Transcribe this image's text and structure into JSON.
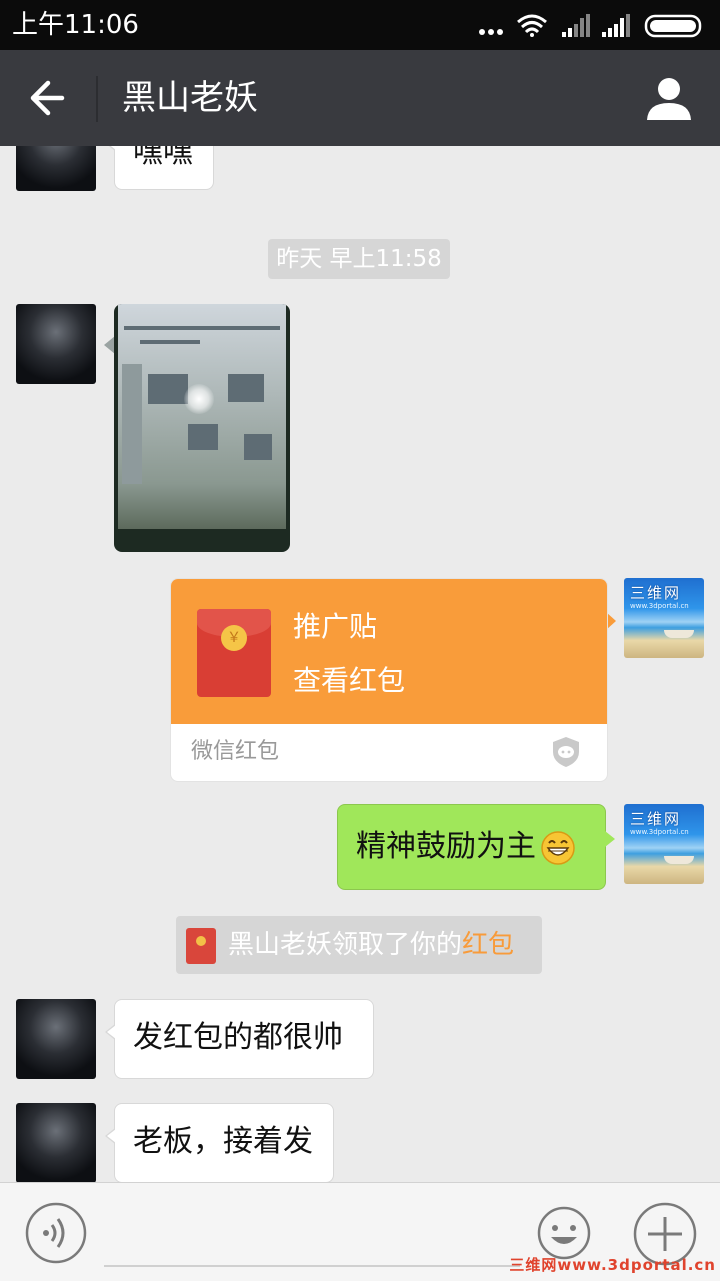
{
  "status_bar": {
    "time": "上午11:06",
    "icons": [
      "more-dots-icon",
      "wifi-icon",
      "signal-icon",
      "signal-icon",
      "battery-icon"
    ]
  },
  "header": {
    "title": "黑山老妖",
    "back_icon": "back-arrow-icon",
    "profile_icon": "person-icon"
  },
  "messages": {
    "m1": {
      "sender": "other",
      "text": "嘿嘿"
    },
    "timestamp": "昨天 早上11:58",
    "m2": {
      "sender": "other",
      "type": "image"
    },
    "m3": {
      "sender": "me",
      "type": "red_packet",
      "title": "推广贴",
      "subtitle": "查看红包",
      "footer": "微信红包",
      "coin_symbol": "￥"
    },
    "m4": {
      "sender": "me",
      "text": "精神鼓励为主"
    },
    "system_notice": {
      "prefix": "黑山老妖领取了你的",
      "link": "红包"
    },
    "m5": {
      "sender": "other",
      "text": "发红包的都很帅"
    },
    "m6": {
      "sender": "other",
      "text": "老板，接着发"
    }
  },
  "avatar_me": {
    "brand": "三维网",
    "url": "www.3dportal.cn"
  },
  "input_bar": {
    "placeholder": "",
    "voice_icon": "voice-icon",
    "emoji_icon": "emoji-icon",
    "plus_icon": "plus-icon"
  },
  "watermark": "三维网www.3dportal.cn",
  "colors": {
    "header_bg": "#393a3f",
    "chat_bg": "#ebebeb",
    "sent_bubble": "#a0e75a",
    "red_packet": "#f99c3a",
    "link": "#f89b3a"
  }
}
